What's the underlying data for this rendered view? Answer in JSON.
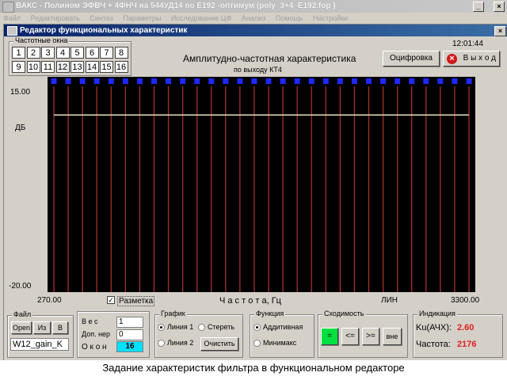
{
  "app": {
    "title": "ВАКС - Полином ЭФВЧ + 4ФНЧ на 544УД14 по Е192 -оптимум (poly_3+4_E192.fop )",
    "menu": [
      "Файл",
      "Редактировать",
      "Синтез",
      "Параметры",
      "Исследование ЦФ",
      "Анализ",
      "Помощь",
      "Настройки"
    ],
    "min_glyph": "_",
    "close_glyph": "×"
  },
  "editor": {
    "title": "Редактор функциональных характеристик",
    "close_glyph": "×",
    "time": "12:01:44"
  },
  "freq_windows": {
    "label": "Частотные окна",
    "buttons": [
      "1",
      "2",
      "3",
      "4",
      "5",
      "6",
      "7",
      "8",
      "9",
      "10",
      "11",
      "12",
      "13",
      "14",
      "15",
      "16"
    ],
    "selected": "12"
  },
  "header": {
    "chart_title": "Амплитудно-частотная характеристика",
    "chart_subtitle": "по выходу КТ4",
    "digitize_label": "Оцифровка",
    "exit_label": "В ы х о д",
    "exit_glyph": "×"
  },
  "axes": {
    "y_top": "15.00",
    "y_unit": "ДБ",
    "y_bottom": "-20.00",
    "x_left": "270.00",
    "x_right": "3300.00",
    "x_label": "Ч а с т о т а, Гц",
    "x_scale": "ЛИН",
    "markup_label": "Разметка",
    "markup_checked": true
  },
  "chart_data": {
    "type": "line",
    "xlim": [
      270,
      3300
    ],
    "ylim": [
      -20,
      15
    ],
    "xlabel": "Ч а с т о т а, Гц",
    "ylabel": "ДБ",
    "x_scale": "ЛИН",
    "grid": true,
    "marker_count": 30,
    "series": [
      {
        "x": [
          270,
          3300
        ],
        "values": [
          10,
          10
        ]
      }
    ],
    "colors": {
      "background": "#000000",
      "grid": "#a0322d",
      "curve": "#e8e0b8",
      "markers": "#1e28ff"
    }
  },
  "file_panel": {
    "label": "Файл",
    "open_label": "Open",
    "from_label": "Из",
    "to_label": "В",
    "filename": "W12_gain_K"
  },
  "weight_panel": {
    "weight_label": "В е с",
    "weight_value": "1",
    "tol_label": "Доп. нер",
    "tol_value": "0",
    "window_label": "О к о н",
    "window_value": "16"
  },
  "graph_panel": {
    "label": "График",
    "line1": "Линия 1",
    "line2": "Линия 2",
    "erase": "Стереть",
    "clear": "Очистить"
  },
  "func_panel": {
    "label": "Функция",
    "additive": "Аддитивная",
    "minimax": "Минимакс"
  },
  "conv_panel": {
    "label": "Сходимость",
    "eq": "=",
    "le": "<=",
    "ge": ">=",
    "out": "вне"
  },
  "ind_panel": {
    "label": "Индикация",
    "ku_label": "Ku(АЧХ):",
    "ku_value": "2.60",
    "freq_label": "Частота:",
    "freq_value": "2176"
  },
  "caption": "Задание характеристик фильтра в функциональном редакторе"
}
